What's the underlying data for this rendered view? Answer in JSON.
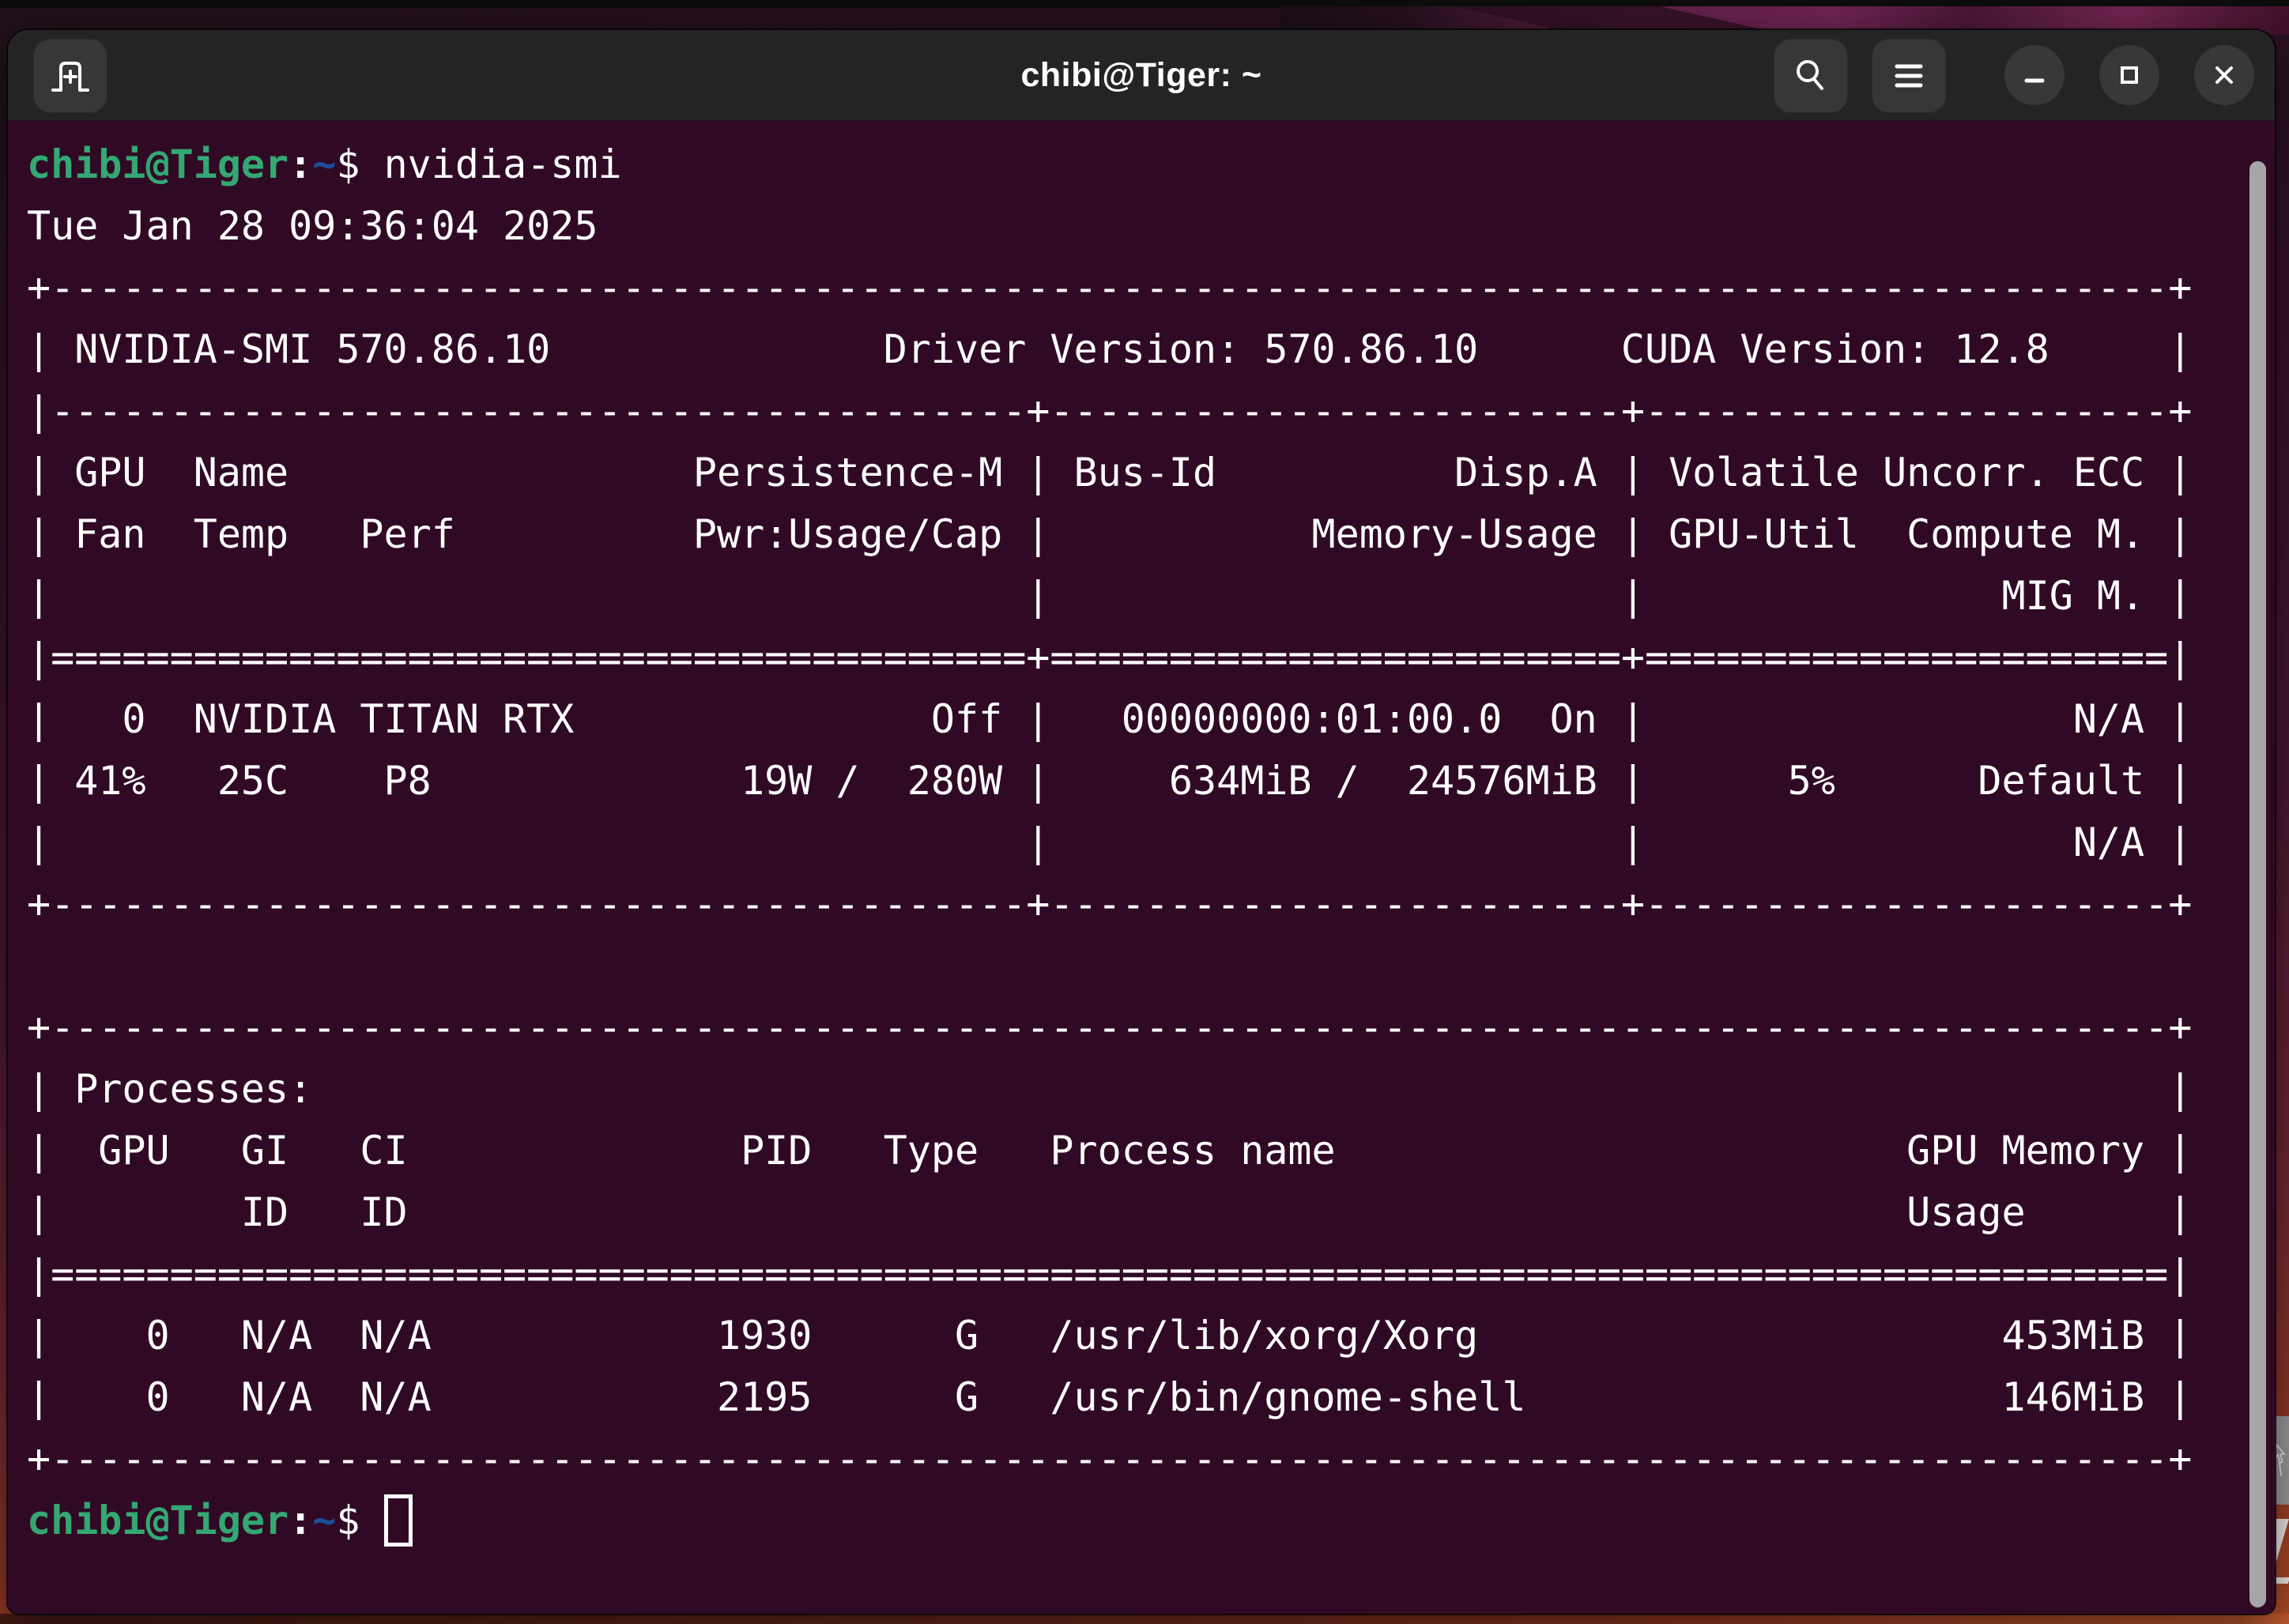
{
  "window": {
    "title": "chibi@Tiger: ~",
    "controls": {
      "new_tab_label": "New Tab",
      "search_label": "Search",
      "menu_label": "Menu",
      "minimize_label": "Minimize",
      "maximize_label": "Maximize",
      "close_label": "Close"
    }
  },
  "colors": {
    "terminal_bg": "#300a24",
    "titlebar_bg": "#242424",
    "prompt_green": "#34a873",
    "prompt_blue": "#1d4e9c",
    "text": "#ffffff",
    "scrollbar": "#a6a6a6"
  },
  "terminal": {
    "prompt": {
      "user_host": "chibi@Tiger",
      "separator": ":",
      "path": "~",
      "symbol": "$"
    },
    "command": "nvidia-smi",
    "date_line": "Tue Jan 28 09:36:04 2025",
    "output_lines": [
      "+-----------------------------------------------------------------------------------------+",
      "| NVIDIA-SMI 570.86.10              Driver Version: 570.86.10      CUDA Version: 12.8     |",
      "|-----------------------------------------+------------------------+----------------------+",
      "| GPU  Name                 Persistence-M | Bus-Id          Disp.A | Volatile Uncorr. ECC |",
      "| Fan  Temp   Perf          Pwr:Usage/Cap |           Memory-Usage | GPU-Util  Compute M. |",
      "|                                         |                        |               MIG M. |",
      "|=========================================+========================+======================|",
      "|   0  NVIDIA TITAN RTX               Off |   00000000:01:00.0  On |                  N/A |",
      "| 41%   25C    P8             19W /  280W |     634MiB /  24576MiB |      5%      Default |",
      "|                                         |                        |                  N/A |",
      "+-----------------------------------------+------------------------+----------------------+",
      "",
      "+-----------------------------------------------------------------------------------------+",
      "| Processes:                                                                              |",
      "|  GPU   GI   CI              PID   Type   Process name                        GPU Memory |",
      "|        ID   ID                                                               Usage      |",
      "|=========================================================================================|",
      "|    0   N/A  N/A            1930      G   /usr/lib/xorg/Xorg                      453MiB |",
      "|    0   N/A  N/A            2195      G   /usr/bin/gnome-shell                    146MiB |",
      "+-----------------------------------------------------------------------------------------+"
    ],
    "gpu_summary": {
      "driver_version": "570.86.10",
      "cuda_version": "12.8",
      "gpu_name": "NVIDIA TITAN RTX",
      "fan": "41%",
      "temp": "25C",
      "perf": "P8",
      "power": "19W / 280W",
      "memory": "634MiB / 24576MiB",
      "gpu_util": "5%",
      "compute_mode": "Default"
    }
  }
}
